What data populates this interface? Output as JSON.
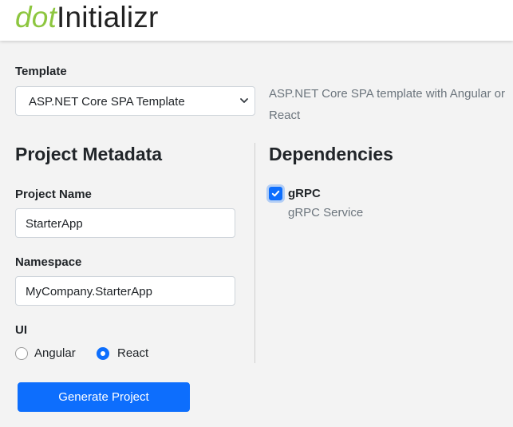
{
  "header": {
    "logo_prefix": "dot",
    "logo_suffix": "Initializr"
  },
  "template": {
    "label": "Template",
    "selected": "ASP.NET Core SPA Template",
    "description": "ASP.NET Core SPA template with Angular or React"
  },
  "metadata": {
    "heading": "Project Metadata",
    "project_name_label": "Project Name",
    "project_name_value": "StarterApp",
    "namespace_label": "Namespace",
    "namespace_value": "MyCompany.StarterApp",
    "ui_label": "UI",
    "ui_options": [
      {
        "label": "Angular",
        "selected": false
      },
      {
        "label": "React",
        "selected": true
      }
    ]
  },
  "dependencies": {
    "heading": "Dependencies",
    "items": [
      {
        "name": "gRPC",
        "description": "gRPC Service",
        "checked": true
      }
    ]
  },
  "actions": {
    "generate_label": "Generate Project"
  },
  "colors": {
    "brand_green": "#8dc63f",
    "primary_blue": "#0d6efd",
    "muted_text": "#6c757d"
  },
  "icons": {
    "select_arrow": "chevron-down-icon",
    "checkbox_mark": "check-icon"
  }
}
